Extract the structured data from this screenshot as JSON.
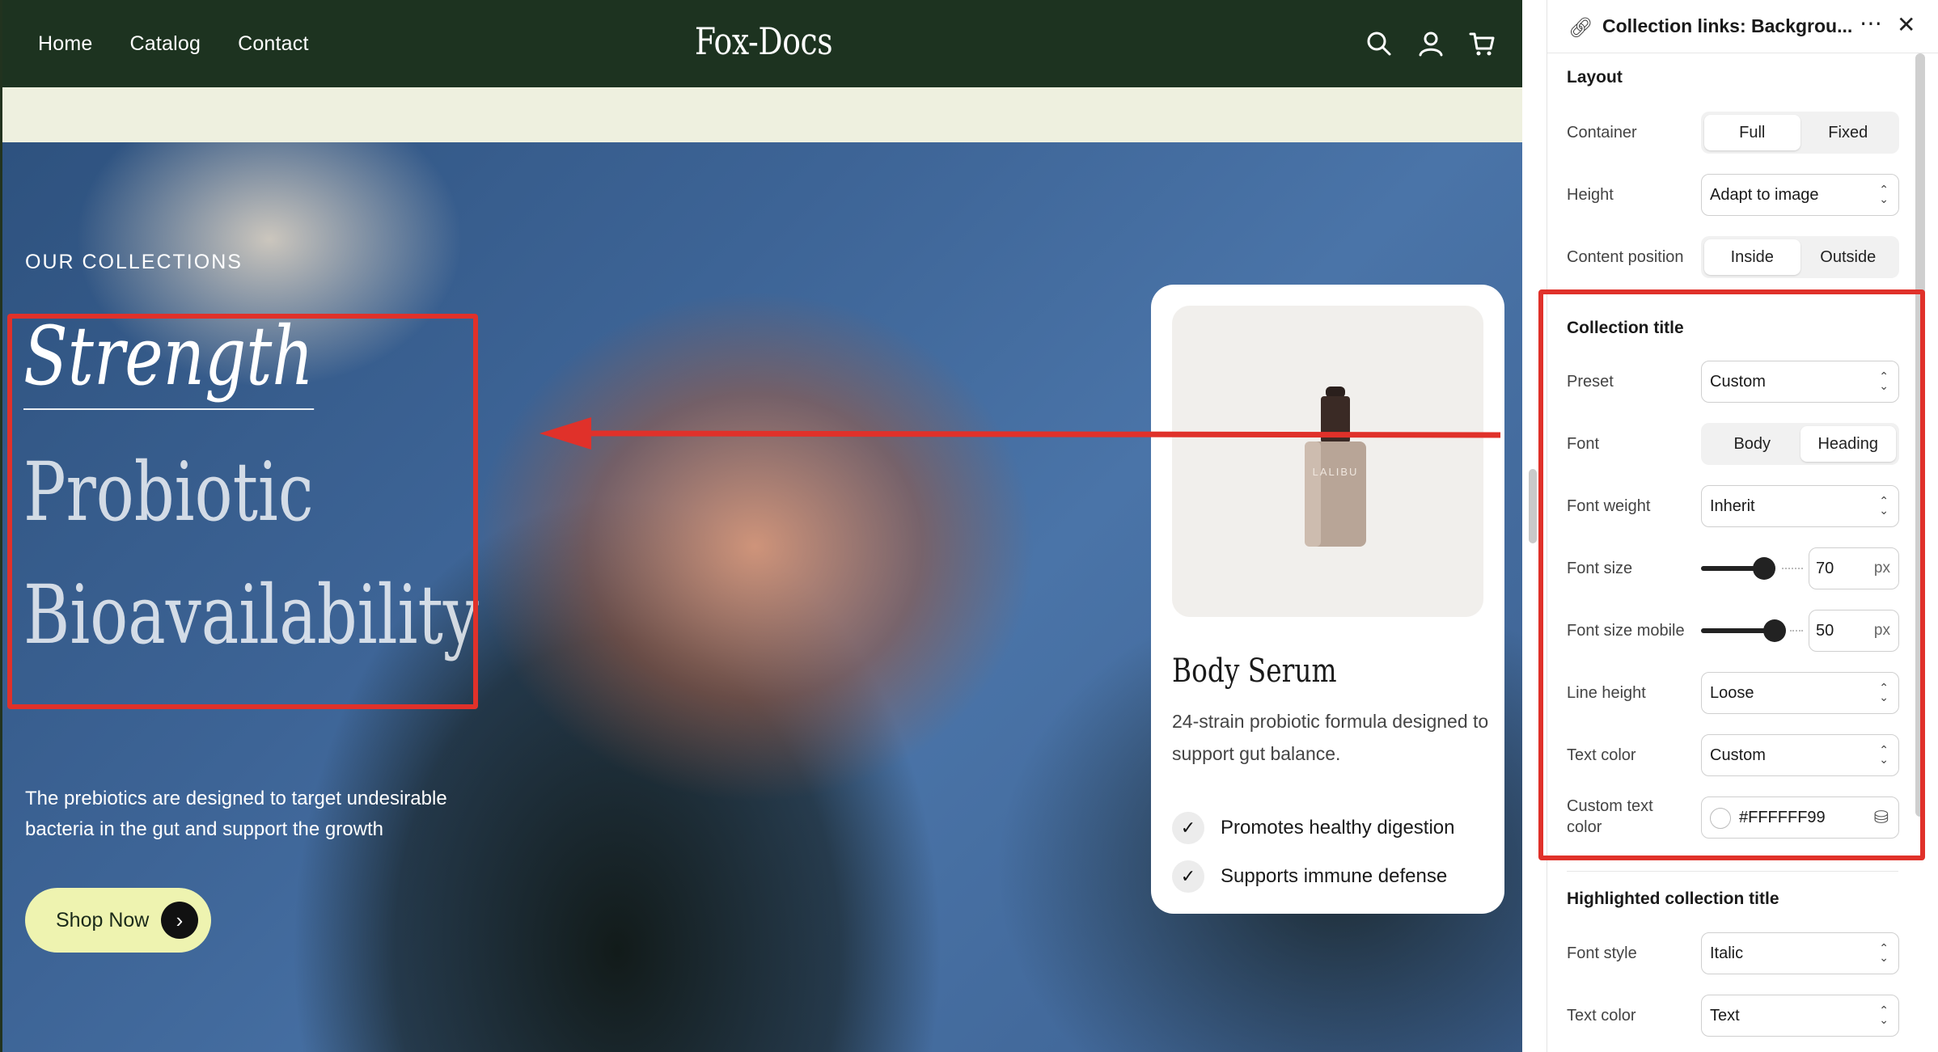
{
  "nav": {
    "links": [
      "Home",
      "Catalog",
      "Contact"
    ],
    "logo": "Fox-Docs",
    "icons": [
      "search-icon",
      "account-icon",
      "cart-icon"
    ]
  },
  "hero": {
    "eyebrow": "OUR COLLECTIONS",
    "title_line1": "Strength",
    "title_line2": "Probiotic",
    "title_line3": "Bioavailability",
    "description": "The prebiotics are designed to target undesirable bacteria in the gut and support the growth",
    "cta_label": "Shop Now",
    "cta_icon": "chevron-right-icon"
  },
  "product_card": {
    "bottle_label": "LALIBU",
    "title": "Body Serum",
    "description": "24-strain probiotic formula designed to support gut balance.",
    "features": [
      "Promotes healthy digestion",
      "Supports immune defense"
    ]
  },
  "panel": {
    "title": "Collection links: Backgrou...",
    "layout": {
      "heading": "Layout",
      "container_label": "Container",
      "container_options": [
        "Full",
        "Fixed"
      ],
      "container_selected": "Full",
      "height_label": "Height",
      "height_value": "Adapt to image",
      "content_position_label": "Content position",
      "content_position_options": [
        "Inside",
        "Outside"
      ],
      "content_position_selected": "Inside"
    },
    "collection_title": {
      "heading": "Collection title",
      "preset_label": "Preset",
      "preset_value": "Custom",
      "font_label": "Font",
      "font_options": [
        "Body",
        "Heading"
      ],
      "font_selected": "Heading",
      "font_weight_label": "Font weight",
      "font_weight_value": "Inherit",
      "font_size_label": "Font size",
      "font_size_value": "70",
      "font_size_unit": "px",
      "font_size_mobile_label": "Font size mobile",
      "font_size_mobile_value": "50",
      "font_size_mobile_unit": "px",
      "line_height_label": "Line height",
      "line_height_value": "Loose",
      "text_color_label": "Text color",
      "text_color_value": "Custom",
      "custom_text_color_label": "Custom text color",
      "custom_text_color_value": "#FFFFFF99"
    },
    "highlighted_title": {
      "heading": "Highlighted collection title",
      "font_style_label": "Font style",
      "font_style_value": "Italic",
      "text_color_label": "Text color",
      "text_color_value": "Text"
    }
  },
  "colors": {
    "nav_bg": "#1d3320",
    "strip_bg": "#eef0df",
    "cta_bg": "#eef3b0",
    "annotation_red": "#e0312a"
  }
}
